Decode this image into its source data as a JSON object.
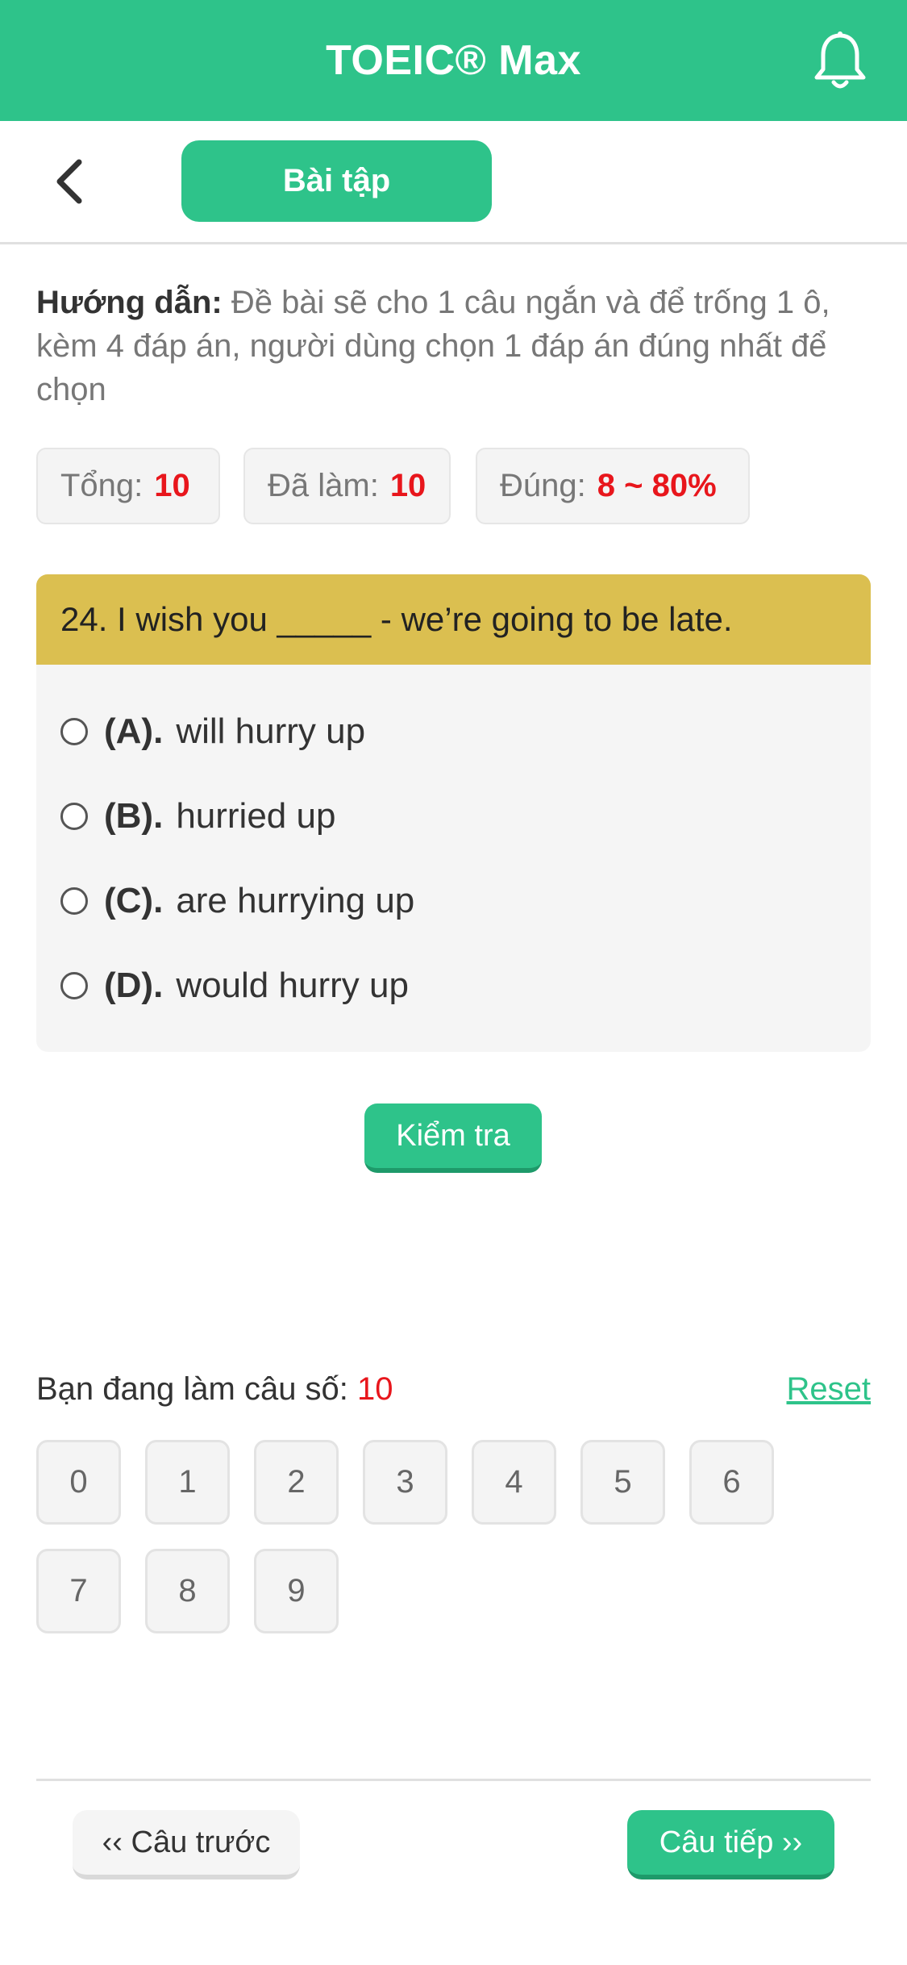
{
  "app": {
    "title": "TOEIC® Max"
  },
  "nav": {
    "tab_label": "Bài tập"
  },
  "instruction": {
    "label": "Hướng dẫn:",
    "text": " Đề bài sẽ cho 1 câu ngắn và để trống 1 ô, kèm 4 đáp án, người dùng chọn 1 đáp án đúng nhất để chọn"
  },
  "stats": {
    "total_label": "Tổng:",
    "total_value": "10",
    "done_label": "Đã làm:",
    "done_value": "10",
    "correct_label": "Đúng:",
    "correct_value": "8 ~ 80%"
  },
  "question": {
    "text": "24. I wish you _____ - we’re going to be late.",
    "options": [
      {
        "label": "(A).",
        "text": "will hurry up"
      },
      {
        "label": "(B).",
        "text": "hurried up"
      },
      {
        "label": "(C).",
        "text": "are hurrying up"
      },
      {
        "label": "(D).",
        "text": "would hurry up"
      }
    ]
  },
  "check_button": "Kiểm tra",
  "progress": {
    "label": "Bạn đang làm câu số:",
    "current": "10",
    "reset": "Reset",
    "numbers": [
      "0",
      "1",
      "2",
      "3",
      "4",
      "5",
      "6",
      "7",
      "8",
      "9"
    ]
  },
  "footer": {
    "prev": "‹‹ Câu trước",
    "next": "Câu tiếp ››"
  },
  "colors": {
    "primary": "#2ec38a",
    "question_header": "#dbbf50",
    "highlight": "#e8161c"
  }
}
